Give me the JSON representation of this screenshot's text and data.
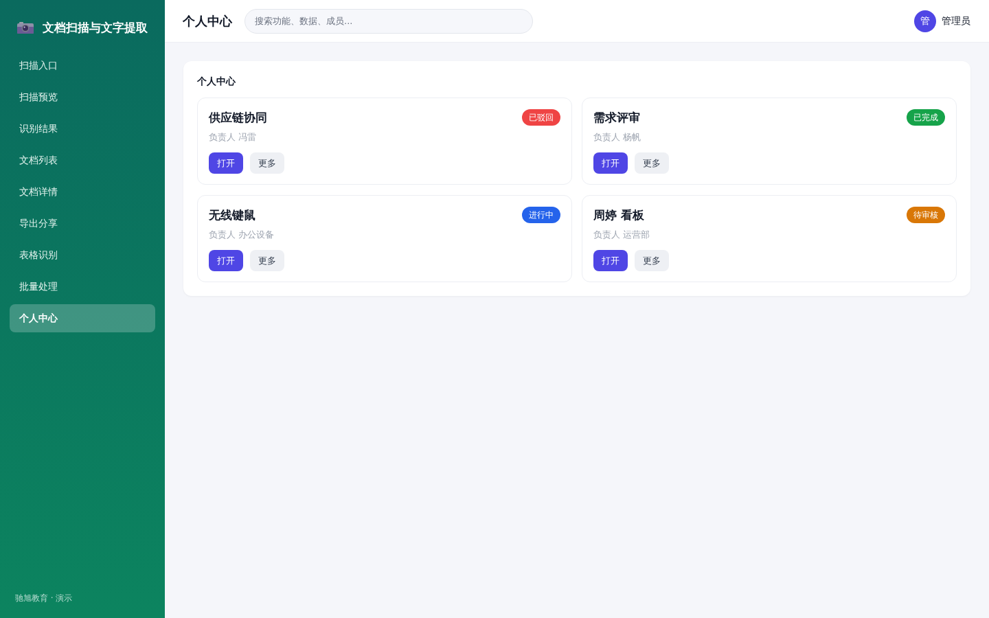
{
  "sidebar": {
    "brand": {
      "title": "文档扫描与文字提取"
    },
    "items": [
      {
        "label": "扫描入口",
        "selected": false
      },
      {
        "label": "扫描预览",
        "selected": false
      },
      {
        "label": "识别结果",
        "selected": false
      },
      {
        "label": "文档列表",
        "selected": false
      },
      {
        "label": "文档详情",
        "selected": false
      },
      {
        "label": "导出分享",
        "selected": false
      },
      {
        "label": "表格识别",
        "selected": false
      },
      {
        "label": "批量处理",
        "selected": false
      },
      {
        "label": "个人中心",
        "selected": true
      }
    ],
    "footer": "驰旭教育 · 演示"
  },
  "topbar": {
    "title": "个人中心",
    "search": {
      "placeholder": "搜索功能、数据、成员..."
    },
    "user": {
      "avatar": "管",
      "name": "管理员"
    }
  },
  "panel": {
    "title": "个人中心",
    "cards": [
      {
        "title": "供应链协同",
        "status": "已驳回",
        "color": "#ef4444",
        "owner": "负责人 冯雷",
        "buttons": [
          {
            "label": "打开",
            "kind": "primary"
          },
          {
            "label": "更多",
            "kind": "secondary"
          }
        ]
      },
      {
        "title": "需求评审",
        "status": "已完成",
        "color": "#16a34a",
        "owner": "负责人 杨帆",
        "buttons": [
          {
            "label": "打开",
            "kind": "primary"
          },
          {
            "label": "更多",
            "kind": "secondary"
          }
        ]
      },
      {
        "title": "无线键鼠",
        "status": "进行中",
        "color": "#2563eb",
        "owner": "负责人 办公设备",
        "buttons": [
          {
            "label": "打开",
            "kind": "primary"
          },
          {
            "label": "更多",
            "kind": "secondary"
          }
        ]
      },
      {
        "title": "周婷 看板",
        "status": "待审核",
        "color": "#d97706",
        "owner": "负责人 运营部",
        "buttons": [
          {
            "label": "打开",
            "kind": "primary"
          },
          {
            "label": "更多",
            "kind": "secondary"
          }
        ]
      }
    ]
  }
}
